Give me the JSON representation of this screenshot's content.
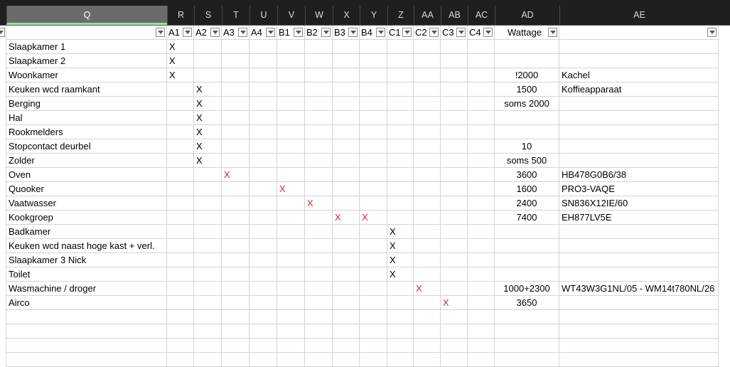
{
  "columns": [
    "Q",
    "R",
    "S",
    "T",
    "U",
    "V",
    "W",
    "X",
    "Y",
    "Z",
    "AA",
    "AB",
    "AC",
    "AD",
    "AE"
  ],
  "selected_column": "Q",
  "filter_headers": {
    "Q": "",
    "R": "A1",
    "S": "A2",
    "T": "A3",
    "U": "A4",
    "V": "B1",
    "W": "B2",
    "X": "B3",
    "Y": "B4",
    "Z": "C1",
    "AA": "C2",
    "AB": "C3",
    "AC": "C4",
    "AD": "Wattage",
    "AE": ""
  },
  "rows": [
    {
      "name": "Slaapkamer 1",
      "marks": {
        "R": "X"
      },
      "wattage": "",
      "note": ""
    },
    {
      "name": "Slaapkamer 2",
      "marks": {
        "R": "X"
      },
      "wattage": "",
      "note": ""
    },
    {
      "name": "Woonkamer",
      "marks": {
        "R": "X"
      },
      "wattage": "!2000",
      "note": "Kachel"
    },
    {
      "name": "Keuken wcd raamkant",
      "marks": {
        "S": "X"
      },
      "wattage": "1500",
      "note": "Koffieapparaat"
    },
    {
      "name": "Berging",
      "marks": {
        "S": "X"
      },
      "wattage": "soms 2000",
      "note": ""
    },
    {
      "name": "Hal",
      "marks": {
        "S": "X"
      },
      "wattage": "",
      "note": ""
    },
    {
      "name": "Rookmelders",
      "marks": {
        "S": "X"
      },
      "wattage": "",
      "note": ""
    },
    {
      "name": "Stopcontact deurbel",
      "marks": {
        "S": "X"
      },
      "wattage": "10",
      "note": ""
    },
    {
      "name": "Zolder",
      "marks": {
        "S": "X"
      },
      "wattage": "soms 500",
      "note": ""
    },
    {
      "name": "Oven",
      "marks": {
        "T": "X"
      },
      "red": true,
      "wattage": "3600",
      "note": "HB478G0B6/38"
    },
    {
      "name": "Quooker",
      "marks": {
        "V": "X"
      },
      "red": true,
      "wattage": "1600",
      "note": "PRO3-VAQE"
    },
    {
      "name": "Vaatwasser",
      "marks": {
        "W": "X"
      },
      "red": true,
      "wattage": "2400",
      "note": "SN836X12IE/60"
    },
    {
      "name": "Kookgroep",
      "marks": {
        "X": "X",
        "Y": "X"
      },
      "red": true,
      "wattage": "7400",
      "note": "EH877LV5E"
    },
    {
      "name": "Badkamer",
      "marks": {
        "Z": "X"
      },
      "wattage": "",
      "note": ""
    },
    {
      "name": "Keuken wcd naast hoge kast + verl.",
      "marks": {
        "Z": "X"
      },
      "wattage": "",
      "note": ""
    },
    {
      "name": "Slaapkamer 3 Nick",
      "marks": {
        "Z": "X"
      },
      "wattage": "",
      "note": ""
    },
    {
      "name": "Toilet",
      "marks": {
        "Z": "X"
      },
      "wattage": "",
      "note": ""
    },
    {
      "name": "Wasmachine / droger",
      "marks": {
        "AA": "X"
      },
      "red": true,
      "wattage": "1000+2300",
      "note": "WT43W3G1NL/05 - WM14t780NL/26"
    },
    {
      "name": "Airco",
      "marks": {
        "AB": "X"
      },
      "red": true,
      "wattage": "3650",
      "note": ""
    }
  ],
  "colors": {
    "header_bg": "#1f1f1f",
    "selected_header_bg": "#6b6b6b",
    "red_mark": "#e02020",
    "grid_line": "#d4d4d4"
  }
}
